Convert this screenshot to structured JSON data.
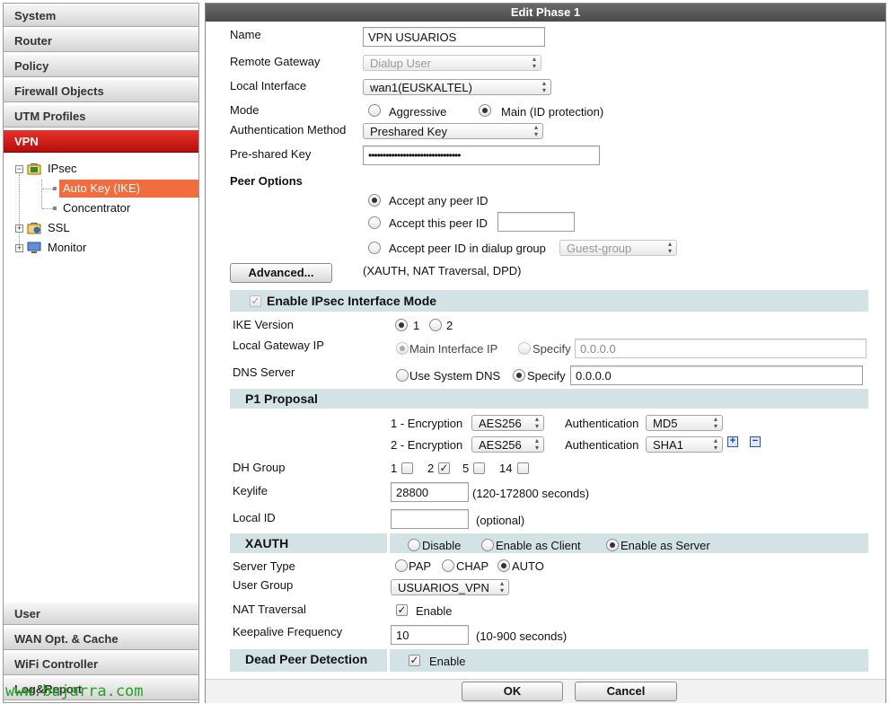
{
  "sidebar": {
    "top_items": [
      "System",
      "Router",
      "Policy",
      "Firewall Objects",
      "UTM Profiles",
      "VPN"
    ],
    "tree": {
      "ipsec": "IPsec",
      "auto_key": "Auto Key (IKE)",
      "concentrator": "Concentrator",
      "ssl": "SSL",
      "monitor": "Monitor"
    },
    "bottom_items": [
      "User",
      "WAN Opt. & Cache",
      "WiFi Controller",
      "Log&Report"
    ]
  },
  "watermark": "www.bujarra.com",
  "panel": {
    "title": "Edit Phase 1",
    "name_label": "Name",
    "name_value": "VPN USUARIOS",
    "remote_gateway_label": "Remote Gateway",
    "remote_gateway_value": "Dialup User",
    "local_interface_label": "Local Interface",
    "local_interface_value": "wan1(EUSKALTEL)",
    "mode_label": "Mode",
    "mode_aggressive": "Aggressive",
    "mode_main": "Main (ID protection)",
    "auth_method_label": "Authentication Method",
    "auth_method_value": "Preshared Key",
    "psk_label": "Pre-shared Key",
    "psk_value": "••••••••••••••••••••••••••••••••",
    "peer_options_label": "Peer Options",
    "peer_any": "Accept any peer ID",
    "peer_this": "Accept this peer ID",
    "peer_group": "Accept peer ID in dialup group",
    "peer_group_value": "Guest-group",
    "advanced_button": "Advanced...",
    "advanced_note": "(XAUTH, NAT Traversal, DPD)",
    "enable_interface_mode": "Enable IPsec Interface Mode",
    "ike_version_label": "IKE Version",
    "ike_v1": "1",
    "ike_v2": "2",
    "local_gw_label": "Local Gateway IP",
    "local_gw_main": "Main Interface IP",
    "local_gw_specify": "Specify",
    "local_gw_value": "0.0.0.0",
    "dns_label": "DNS Server",
    "dns_system": "Use System DNS",
    "dns_specify": "Specify",
    "dns_value": "0.0.0.0",
    "p1_proposal": "P1 Proposal",
    "enc1_label": "1 - Encryption",
    "enc1_value": "AES256",
    "auth1_label": "Authentication",
    "auth1_value": "MD5",
    "enc2_label": "2 - Encryption",
    "enc2_value": "AES256",
    "auth2_label": "Authentication",
    "auth2_value": "SHA1",
    "dh_label": "DH Group",
    "dh_opts": [
      "1",
      "2",
      "5",
      "14"
    ],
    "keylife_label": "Keylife",
    "keylife_value": "28800",
    "keylife_note": "(120-172800 seconds)",
    "local_id_label": "Local ID",
    "local_id_value": "",
    "local_id_note": "(optional)",
    "xauth": "XAUTH",
    "xauth_disable": "Disable",
    "xauth_client": "Enable as Client",
    "xauth_server": "Enable as Server",
    "server_type_label": "Server Type",
    "server_pap": "PAP",
    "server_chap": "CHAP",
    "server_auto": "AUTO",
    "user_group_label": "User Group",
    "user_group_value": "USUARIOS_VPN",
    "nat_label": "NAT Traversal",
    "nat_enable": "Enable",
    "keepalive_label": "Keepalive Frequency",
    "keepalive_value": "10",
    "keepalive_note": "(10-900 seconds)",
    "dpd": "Dead Peer Detection",
    "dpd_enable": "Enable",
    "ok_button": "OK",
    "cancel_button": "Cancel"
  },
  "colors": {
    "active_nav": "#c8120d",
    "tree_selection": "#f36c3d",
    "section_band": "#d3e3e5",
    "titlebar": "#555555",
    "watermark": "#1fa51f"
  }
}
